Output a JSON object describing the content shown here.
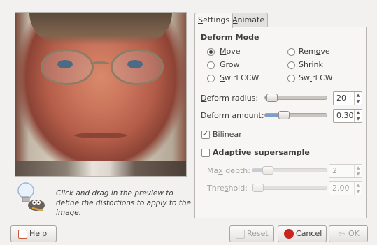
{
  "tabs": [
    {
      "label_pre": "",
      "label_ul": "S",
      "label_post": "ettings"
    },
    {
      "label_pre": "",
      "label_ul": "A",
      "label_post": "nimate"
    }
  ],
  "deform_mode": {
    "title": "Deform Mode",
    "options": [
      {
        "pre": "",
        "ul": "M",
        "post": "ove",
        "selected": true
      },
      {
        "pre": "",
        "ul": "G",
        "post": "row",
        "selected": false
      },
      {
        "pre": "",
        "ul": "S",
        "post": "wirl CCW",
        "selected": false
      },
      {
        "pre": "Rem",
        "ul": "o",
        "post": "ve",
        "selected": false
      },
      {
        "pre": "S",
        "ul": "h",
        "post": "rink",
        "selected": false
      },
      {
        "pre": "Sw",
        "ul": "i",
        "post": "rl CW",
        "selected": false
      }
    ]
  },
  "deform_radius": {
    "pre": "",
    "ul": "D",
    "post": "eform radius:",
    "value": "20",
    "level": 0.1
  },
  "deform_amount": {
    "pre": "Deform ",
    "ul": "a",
    "post": "mount:",
    "value": "0.30",
    "level": 0.3
  },
  "bilinear": {
    "pre": "",
    "ul": "B",
    "post": "ilinear",
    "checked": true
  },
  "adaptive": {
    "pre": "Adaptive ",
    "ul": "s",
    "post": "upersample",
    "checked": false
  },
  "max_depth": {
    "pre": "Ma",
    "ul": "x",
    "post": " depth:",
    "value": "2",
    "level": 0.2
  },
  "threshold": {
    "pre": "Thre",
    "ul": "s",
    "post": "hold:",
    "value": "2.00",
    "level": 0.05
  },
  "hint": "Click and drag in the preview to define the distortions to apply to the image.",
  "buttons": {
    "help": {
      "pre": "",
      "ul": "H",
      "post": "elp"
    },
    "reset": {
      "pre": "",
      "ul": "R",
      "post": "eset"
    },
    "cancel": {
      "pre": "",
      "ul": "C",
      "post": "ancel"
    },
    "ok": {
      "pre": "",
      "ul": "O",
      "post": "K"
    }
  },
  "colors": {
    "accent": "#7f9fc8",
    "cancel_icon": "#c8251e",
    "help_icon": "#c85a3c"
  }
}
